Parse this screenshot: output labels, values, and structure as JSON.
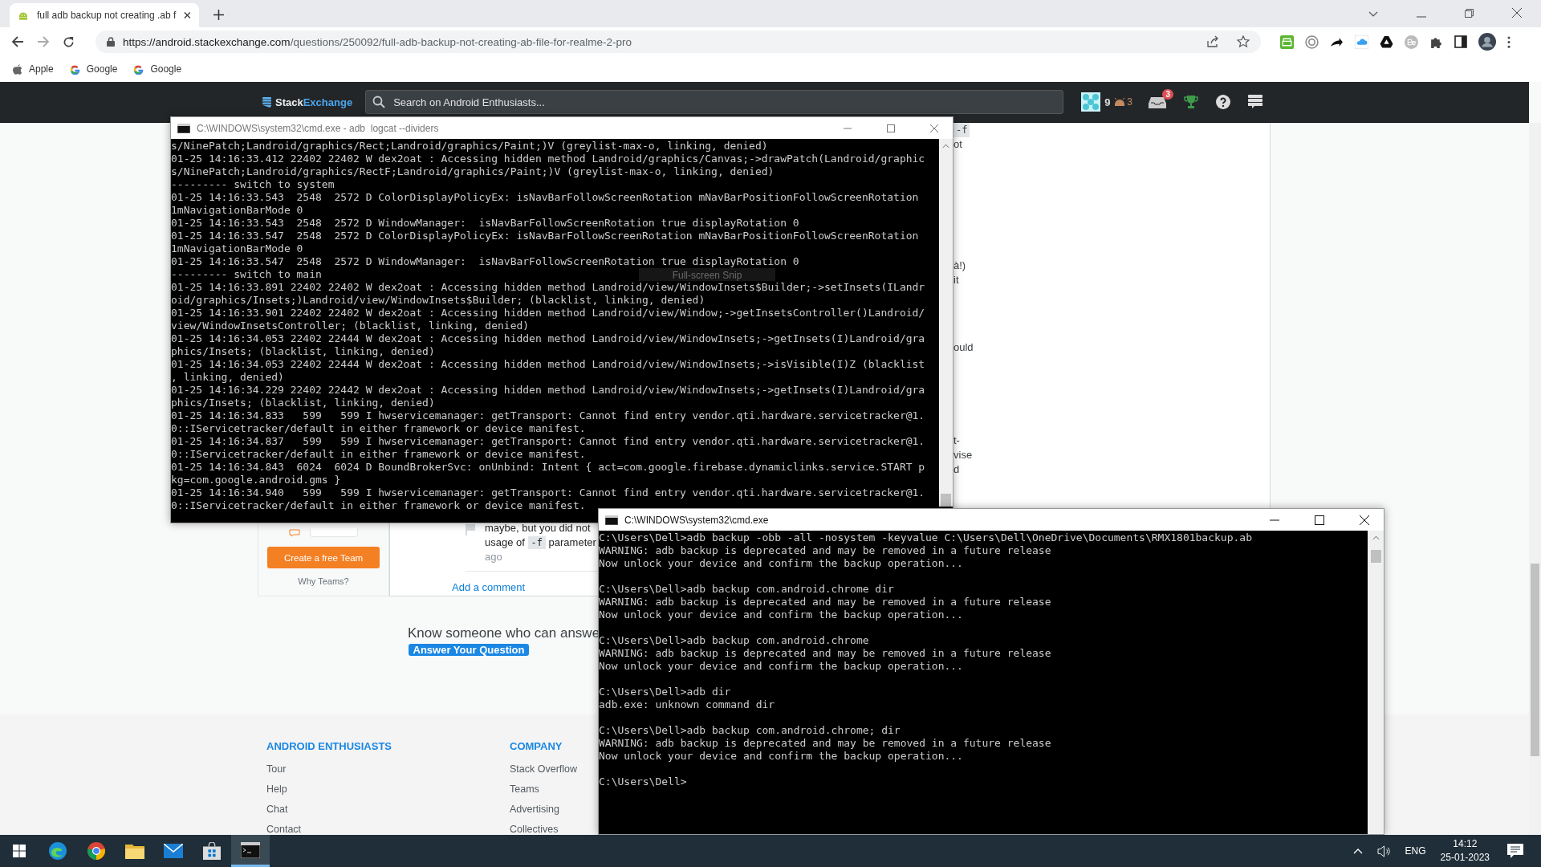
{
  "browser": {
    "tabs": [
      {
        "title": "full adb backup not creating .ab f",
        "selected": true
      }
    ],
    "url": {
      "host": "https://android.stackexchange.com",
      "path": "/questions/250092/full-adb-backup-not-creating-ab-file-for-realme-2-pro"
    },
    "bookmarks": [
      {
        "label": "Apple",
        "kind": "apple"
      },
      {
        "label": "Google",
        "kind": "google"
      },
      {
        "label": "Google",
        "kind": "google"
      }
    ]
  },
  "site_header": {
    "logo": {
      "first": "Stack",
      "second": "Exchange"
    },
    "search": {
      "placeholder": "Search on Android Enthusiasts..."
    },
    "reputation": "9",
    "badge_count": "3",
    "inbox_count": "3"
  },
  "page": {
    "sidebar": {
      "button": "Create a free Team",
      "link": "Why Teams?"
    },
    "fragments": [
      {
        "text": "-f",
        "kind": "code"
      },
      {
        "text": "ot",
        "kind": "text"
      },
      {
        "text": "à!)",
        "kind": "text"
      },
      {
        "text": "it",
        "kind": "text"
      },
      {
        "text": "ould",
        "kind": "text"
      },
      {
        "text": "t-",
        "kind": "text"
      },
      {
        "text": "vise",
        "kind": "text"
      },
      {
        "text": "d",
        "kind": "text"
      }
    ],
    "comment": {
      "line_1": "maybe, but you did not",
      "before_code": "usage of",
      "code": "-f",
      "after_code": "parameter",
      "age": "ago"
    },
    "add_comment": "Add a comment",
    "know_someone": "Know someone who can answe",
    "answer_button": "Answer Your Question",
    "footer": [
      {
        "heading": "ANDROID ENTHUSIASTS",
        "links": [
          "Tour",
          "Help",
          "Chat",
          "Contact"
        ]
      },
      {
        "heading": "COMPANY",
        "links": [
          "Stack Overflow",
          "Teams",
          "Advertising",
          "Collectives"
        ]
      }
    ]
  },
  "windows": [
    {
      "title": "C:\\WINDOWS\\system32\\cmd.exe - adb  logcat --dividers",
      "active": false,
      "overlay": "Full-screen Snip",
      "lines": [
        "s/NinePatch;Landroid/graphics/Rect;Landroid/graphics/Paint;)V (greylist-max-o, linking, denied)",
        "01-25 14:16:33.412 22402 22402 W dex2oat : Accessing hidden method Landroid/graphics/Canvas;->drawPatch(Landroid/graphic",
        "s/NinePatch;Landroid/graphics/RectF;Landroid/graphics/Paint;)V (greylist-max-o, linking, denied)",
        "--------- switch to system",
        "01-25 14:16:33.543  2548  2572 D ColorDisplayPolicyEx: isNavBarFollowScreenRotation mNavBarPositionFollowScreenRotation",
        "1mNavigationBarMode 0",
        "01-25 14:16:33.543  2548  2572 D WindowManager:  isNavBarFollowScreenRotation true displayRotation 0",
        "01-25 14:16:33.547  2548  2572 D ColorDisplayPolicyEx: isNavBarFollowScreenRotation mNavBarPositionFollowScreenRotation",
        "1mNavigationBarMode 0",
        "01-25 14:16:33.547  2548  2572 D WindowManager:  isNavBarFollowScreenRotation true displayRotation 0",
        "--------- switch to main",
        "01-25 14:16:33.891 22402 22402 W dex2oat : Accessing hidden method Landroid/view/WindowInsets$Builder;->setInsets(ILandr",
        "oid/graphics/Insets;)Landroid/view/WindowInsets$Builder; (blacklist, linking, denied)",
        "01-25 14:16:33.901 22402 22402 W dex2oat : Accessing hidden method Landroid/view/Window;->getInsetsController()Landroid/",
        "view/WindowInsetsController; (blacklist, linking, denied)",
        "01-25 14:16:34.053 22402 22444 W dex2oat : Accessing hidden method Landroid/view/WindowInsets;->getInsets(I)Landroid/gra",
        "phics/Insets; (blacklist, linking, denied)",
        "01-25 14:16:34.053 22402 22444 W dex2oat : Accessing hidden method Landroid/view/WindowInsets;->isVisible(I)Z (blacklist",
        ", linking, denied)",
        "01-25 14:16:34.229 22402 22442 W dex2oat : Accessing hidden method Landroid/view/WindowInsets;->getInsets(I)Landroid/gra",
        "phics/Insets; (blacklist, linking, denied)",
        "01-25 14:16:34.833   599   599 I hwservicemanager: getTransport: Cannot find entry vendor.qti.hardware.servicetracker@1.",
        "0::IServicetracker/default in either framework or device manifest.",
        "01-25 14:16:34.837   599   599 I hwservicemanager: getTransport: Cannot find entry vendor.qti.hardware.servicetracker@1.",
        "0::IServicetracker/default in either framework or device manifest.",
        "01-25 14:16:34.843  6024  6024 D BoundBrokerSvc: onUnbind: Intent { act=com.google.firebase.dynamiclinks.service.START p",
        "kg=com.google.android.gms }",
        "01-25 14:16:34.940   599   599 I hwservicemanager: getTransport: Cannot find entry vendor.qti.hardware.servicetracker@1.",
        "0::IServicetracker/default in either framework or device manifest."
      ]
    },
    {
      "title": "C:\\WINDOWS\\system32\\cmd.exe",
      "active": true,
      "blocks": [
        {
          "lines": [
            "C:\\Users\\Dell>adb backup -obb -all -nosystem -keyvalue C:\\Users\\Dell\\OneDrive\\Documents\\RMX1801backup.ab",
            "WARNING: adb backup is deprecated and may be removed in a future release",
            "Now unlock your device and confirm the backup operation..."
          ]
        },
        {
          "lines": [
            "C:\\Users\\Dell>adb backup com.android.chrome dir",
            "WARNING: adb backup is deprecated and may be removed in a future release",
            "Now unlock your device and confirm the backup operation..."
          ]
        },
        {
          "lines": [
            "C:\\Users\\Dell>adb backup com.android.chrome",
            "WARNING: adb backup is deprecated and may be removed in a future release",
            "Now unlock your device and confirm the backup operation..."
          ]
        },
        {
          "lines": [
            "C:\\Users\\Dell>adb dir",
            "adb.exe: unknown command dir"
          ]
        },
        {
          "lines": [
            "C:\\Users\\Dell>adb backup com.android.chrome; dir",
            "WARNING: adb backup is deprecated and may be removed in a future release",
            "Now unlock your device and confirm the backup operation..."
          ]
        },
        {
          "lines": [
            "C:\\Users\\Dell>"
          ]
        }
      ]
    }
  ],
  "taskbar": {
    "apps": [
      {
        "kind": "edge",
        "selected": false
      },
      {
        "kind": "chrome",
        "selected": false
      },
      {
        "kind": "folder",
        "selected": false
      },
      {
        "kind": "mail",
        "selected": false
      },
      {
        "kind": "store",
        "selected": false
      },
      {
        "kind": "terminal",
        "selected": true
      }
    ],
    "language": "ENG",
    "time": "14:12",
    "date": "25-01-2023"
  }
}
